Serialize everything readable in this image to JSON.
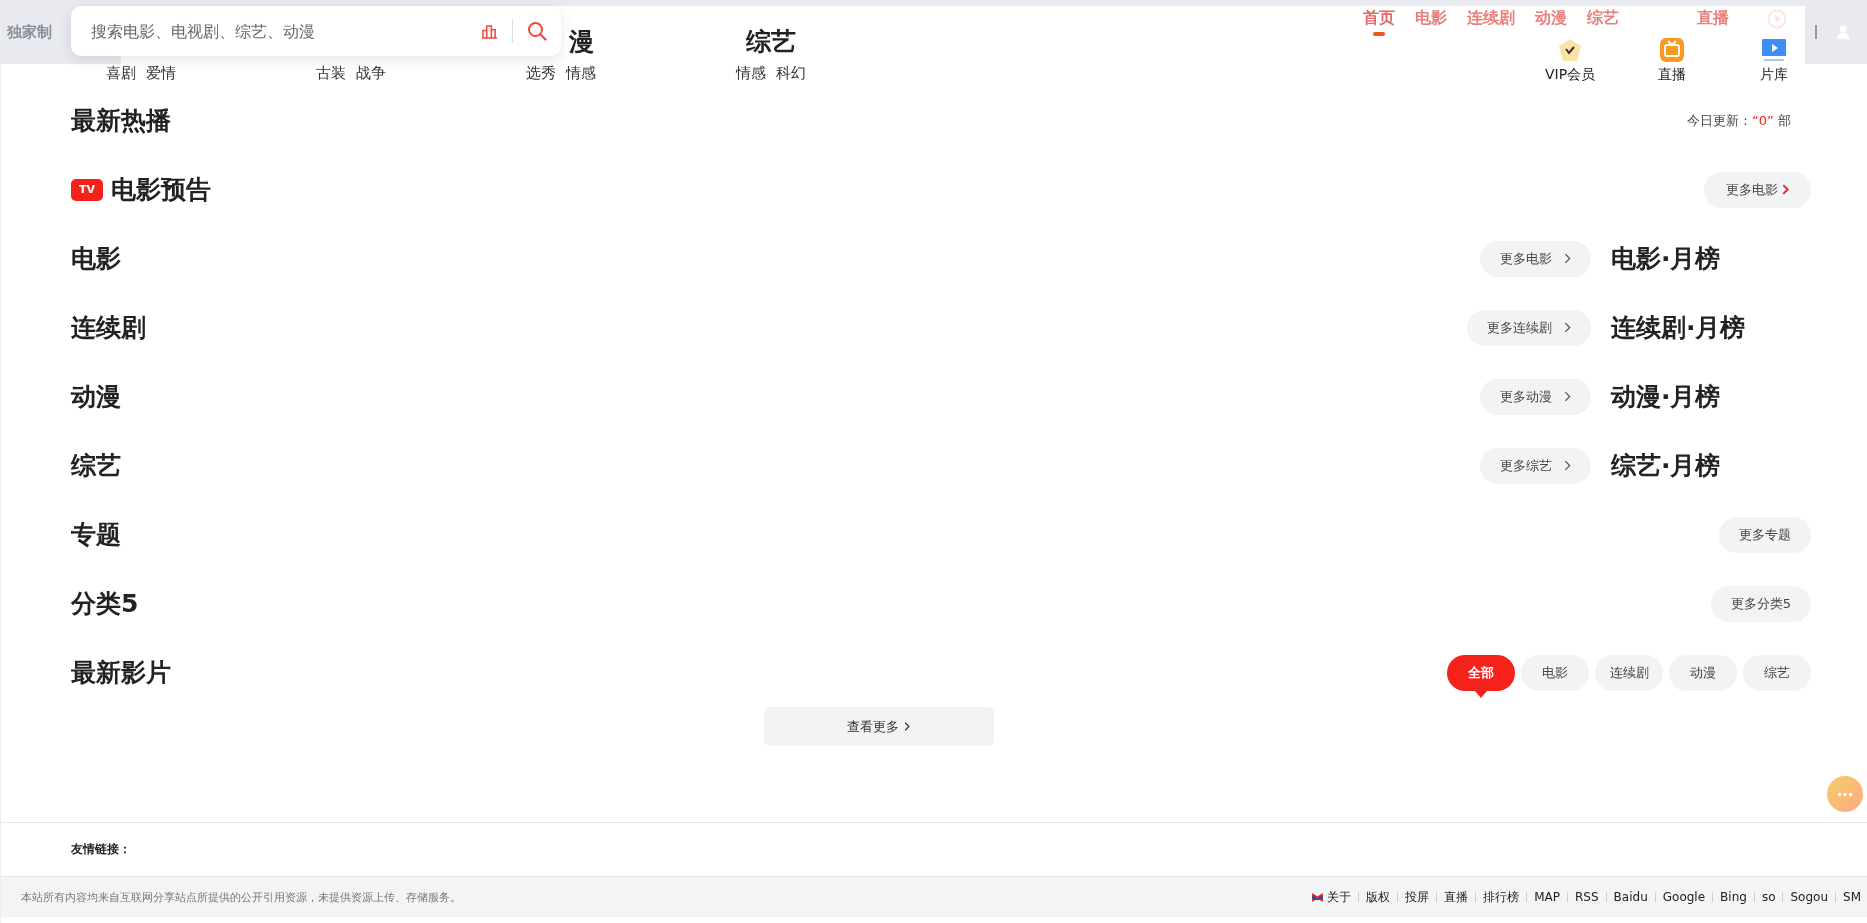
{
  "header": {
    "brand_text": "独家制",
    "search": {
      "placeholder": "搜索电影、电视剧、综艺、动漫"
    },
    "menu_columns": [
      {
        "links": [
          "喜剧",
          "爱情"
        ]
      },
      {
        "links": [
          "古装",
          "战争"
        ]
      },
      {
        "heading": "漫",
        "links": [
          "选秀",
          "情感"
        ]
      },
      {
        "heading": "综艺",
        "links": [
          "情感",
          "科幻"
        ]
      }
    ],
    "nav": [
      {
        "label": "首页",
        "selected": true
      },
      {
        "label": "电影",
        "selected": false
      },
      {
        "label": "连续剧",
        "selected": false
      },
      {
        "label": "动漫",
        "selected": false
      },
      {
        "label": "综艺",
        "selected": false
      },
      {
        "label": "直播",
        "selected": false
      }
    ],
    "quick_links": [
      {
        "kind": "vip",
        "label": "VIP会员"
      },
      {
        "kind": "live",
        "label": "直播"
      },
      {
        "kind": "library",
        "label": "片库"
      }
    ]
  },
  "sections": [
    {
      "kind": "hot",
      "title": "最新热播",
      "update": {
        "label": "今日更新：",
        "count": "“0”",
        "unit": "部"
      }
    },
    {
      "kind": "trailer",
      "badge": "TV",
      "title": "电影预告",
      "more": "更多电影"
    },
    {
      "kind": "ranked",
      "title": "电影",
      "more": "更多电影",
      "rank_title": "电影·月榜"
    },
    {
      "kind": "ranked",
      "title": "连续剧",
      "more": "更多连续剧",
      "rank_title": "连续剧·月榜"
    },
    {
      "kind": "ranked",
      "title": "动漫",
      "more": "更多动漫",
      "rank_title": "动漫·月榜"
    },
    {
      "kind": "ranked",
      "title": "综艺",
      "more": "更多综艺",
      "rank_title": "综艺·月榜"
    },
    {
      "kind": "topic",
      "title": "专题",
      "more": "更多专题"
    },
    {
      "kind": "topic",
      "title": "分类5",
      "more": "更多分类5"
    },
    {
      "kind": "latest",
      "title": "最新影片",
      "tabs": [
        {
          "label": "全部",
          "selected": true
        },
        {
          "label": "电影",
          "selected": false
        },
        {
          "label": "连续剧",
          "selected": false
        },
        {
          "label": "动漫",
          "selected": false
        },
        {
          "label": "综艺",
          "selected": false
        }
      ]
    }
  ],
  "load_more": "查看更多",
  "friend_links": {
    "title": "友情链接："
  },
  "footer": {
    "disclaimer": "本站所有内容均来自互联网分享站点所提供的公开引用资源，未提供资源上传、存储服务。",
    "links": [
      "关于",
      "版权",
      "投屏",
      "直播",
      "排行榜",
      "MAP",
      "RSS",
      "Baidu",
      "Google",
      "Bing",
      "so",
      "Sogou",
      "SM"
    ]
  }
}
